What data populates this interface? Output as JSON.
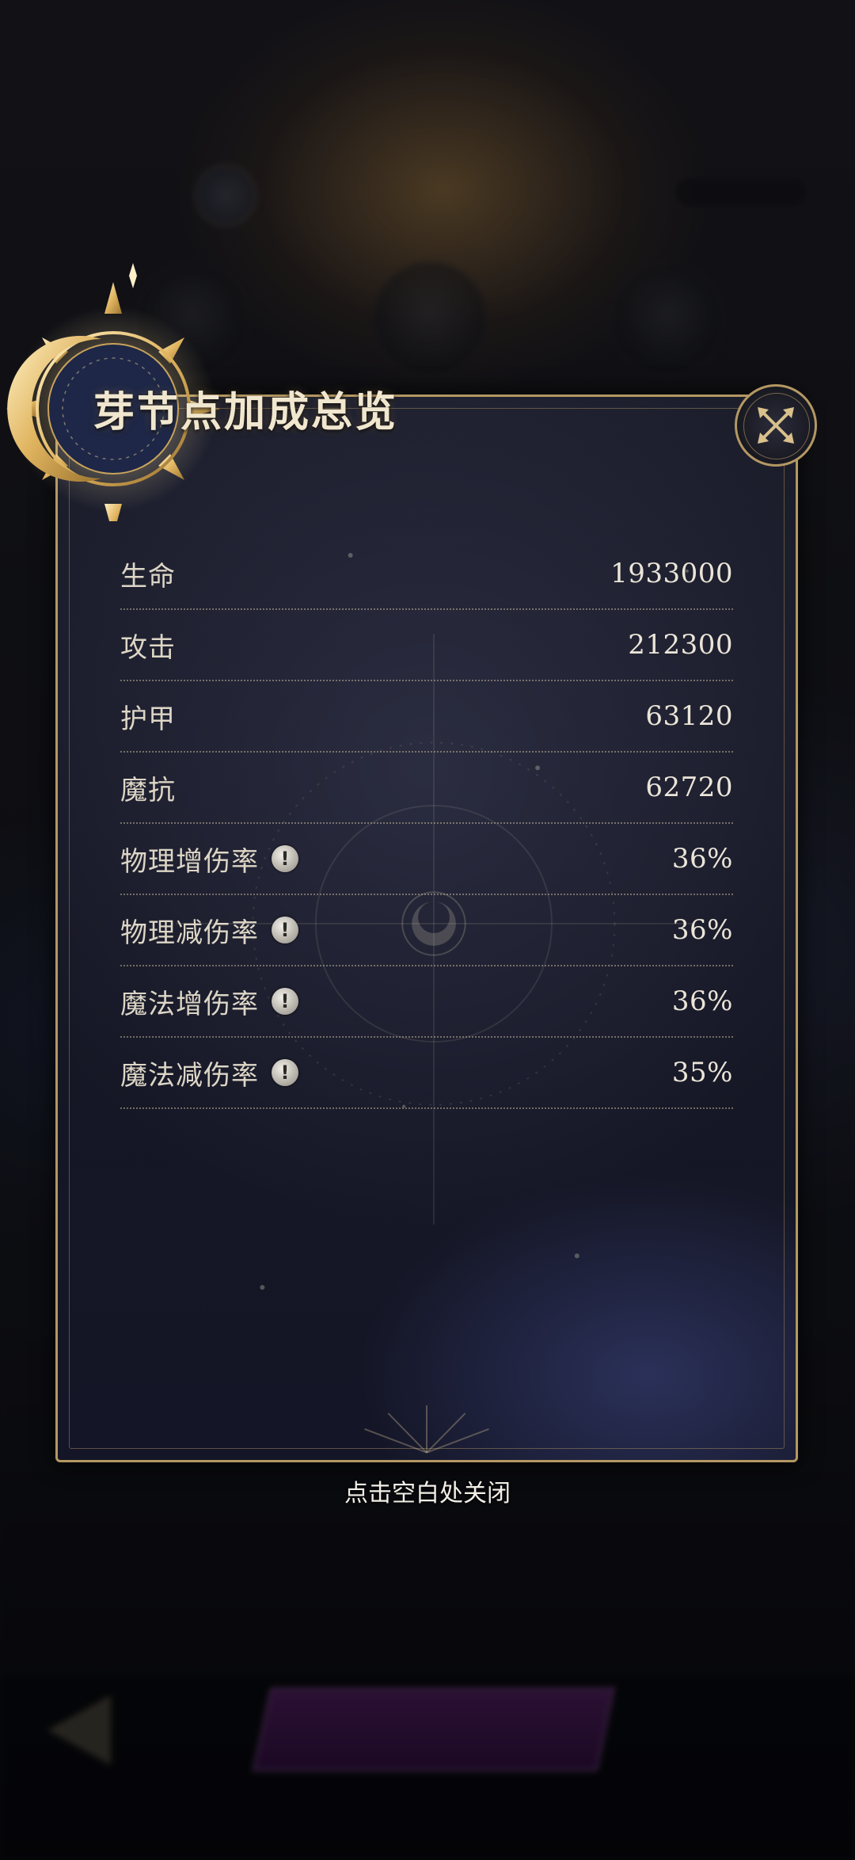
{
  "popup": {
    "title": "芽节点加成总览",
    "close_hint": "点击空白处关闭",
    "stats": [
      {
        "label": "生命",
        "value": "1933000",
        "has_info": false
      },
      {
        "label": "攻击",
        "value": "212300",
        "has_info": false
      },
      {
        "label": "护甲",
        "value": "63120",
        "has_info": false
      },
      {
        "label": "魔抗",
        "value": "62720",
        "has_info": false
      },
      {
        "label": "物理增伤率",
        "value": "36%",
        "has_info": true
      },
      {
        "label": "物理减伤率",
        "value": "36%",
        "has_info": true
      },
      {
        "label": "魔法增伤率",
        "value": "36%",
        "has_info": true
      },
      {
        "label": "魔法减伤率",
        "value": "35%",
        "has_info": true
      }
    ],
    "info_icon_glyph": "!"
  },
  "icons": {
    "close": "close-x-icon",
    "emblem": "crescent-moon-emblem-icon",
    "info": "info-exclamation-icon"
  },
  "colors": {
    "gold_border": "#b49863",
    "panel_bg": "#161724",
    "text_primary": "#ddd6c6",
    "action_purple": "#7a2a8c"
  }
}
